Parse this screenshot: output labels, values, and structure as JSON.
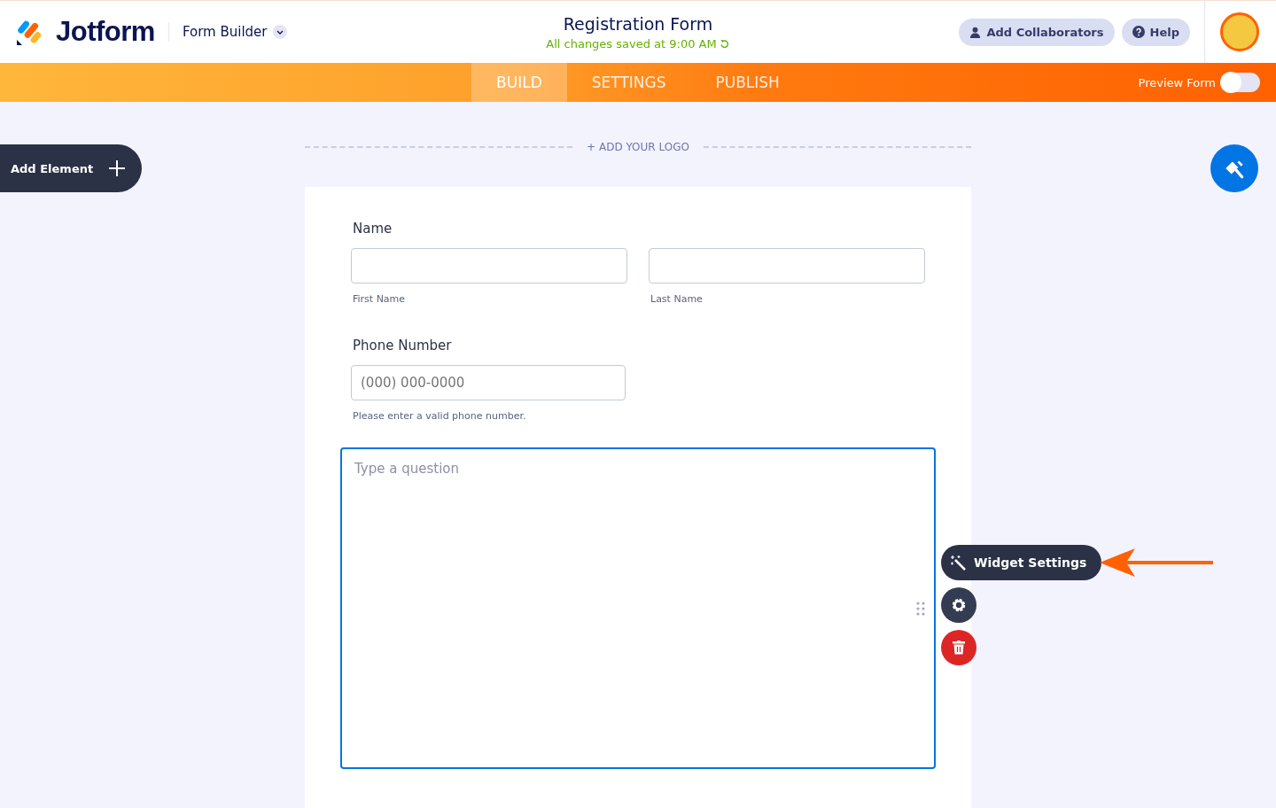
{
  "header": {
    "brand": "Jotform",
    "product": "Form Builder",
    "title": "Registration Form",
    "save_status": "All changes saved at 9:00 AM",
    "buttons": [
      {
        "kind": "collaborators",
        "label": "Add Collaborators"
      },
      {
        "kind": "help",
        "label": "Help"
      }
    ]
  },
  "tabs": [
    {
      "label": "BUILD",
      "selected": true
    },
    {
      "label": "SETTINGS",
      "selected": false
    },
    {
      "label": "PUBLISH",
      "selected": false
    }
  ],
  "preview": {
    "label": "Preview Form",
    "on": false
  },
  "add_element": "Add Element",
  "logo": "+ ADD YOUR LOGO",
  "form": {
    "name": {
      "label": "Name",
      "fields": [
        {
          "sublabel": "First Name"
        },
        {
          "sublabel": "Last Name"
        }
      ]
    },
    "phone": {
      "label": "Phone Number",
      "placeholder": "(000) 000-0000",
      "hint": "Please enter a valid phone number."
    },
    "question": {
      "placeholder": "Type a question"
    }
  },
  "widget_toolbar": {
    "label": "Widget Settings"
  }
}
